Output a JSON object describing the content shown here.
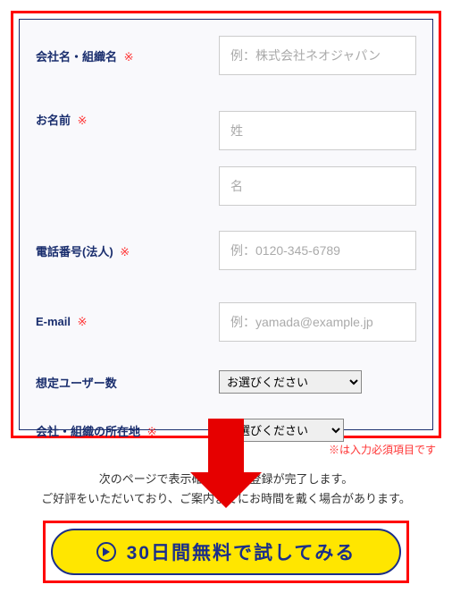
{
  "form": {
    "company": {
      "label": "会社名・組織名",
      "required": "※",
      "placeholder": "例：株式会社ネオジャパン"
    },
    "name": {
      "label": "お名前",
      "required": "※",
      "placeholder_last": "姓",
      "placeholder_first": "名"
    },
    "phone": {
      "label": "電話番号(法人)",
      "required": "※",
      "placeholder": "例：0120-345-6789"
    },
    "email": {
      "label": "E-mail",
      "required": "※",
      "placeholder": "例：yamada@example.jp"
    },
    "users": {
      "label": "想定ユーザー数",
      "option": "お選びください"
    },
    "location": {
      "label": "会社・組織の所在地",
      "required": "※",
      "option": "お選びください"
    }
  },
  "required_note": "※は入力必須項目です",
  "description_line1": "次のページで表示確認後、仮登録が完了します。",
  "description_line2": "ご好評をいただいており、ご案内までにお時間を戴く場合があります。",
  "cta_label": "30日間無料で試してみる"
}
